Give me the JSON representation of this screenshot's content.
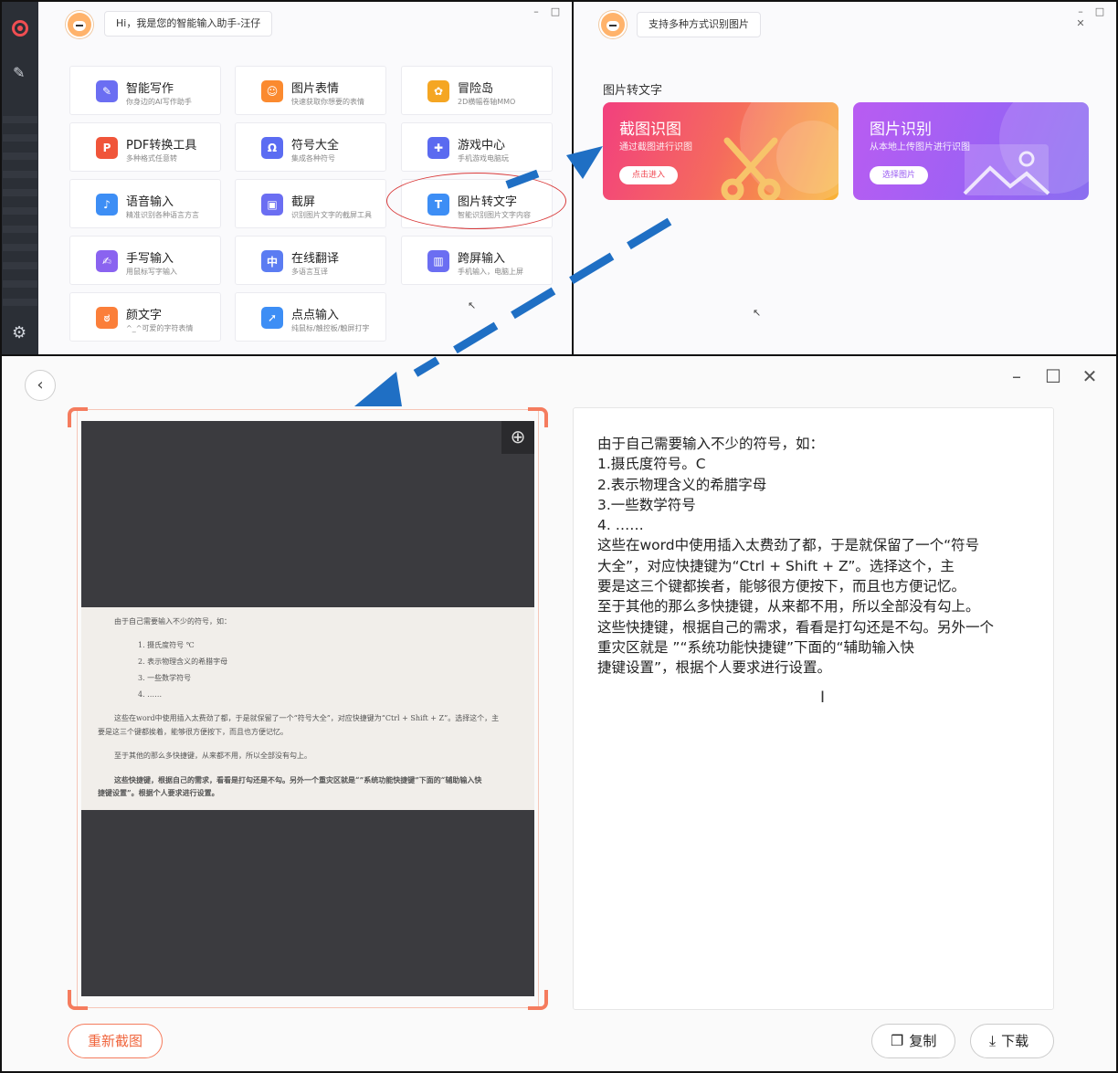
{
  "home": {
    "greeting": "Hi，我是您的智能输入助手-汪仔",
    "cards": [
      {
        "title": "智能写作",
        "subtitle": "你身边的AI写作助手",
        "icon": "pen-icon",
        "color": "#6b6ef2"
      },
      {
        "title": "图片表情",
        "subtitle": "快速获取你想要的表情",
        "icon": "smile-icon",
        "color": "#fb8a2f"
      },
      {
        "title": "冒险岛",
        "subtitle": "2D横幅卷轴MMO",
        "icon": "mushroom-game-icon",
        "color": "#f5a623"
      },
      {
        "title": "PDF转换工具",
        "subtitle": "多种格式任意转",
        "icon": "pdf-icon",
        "color": "#f0553a"
      },
      {
        "title": "符号大全",
        "subtitle": "集成各种符号",
        "icon": "omega-icon",
        "color": "#5b6cf2"
      },
      {
        "title": "游戏中心",
        "subtitle": "手机游戏电脑玩",
        "icon": "gamepad-icon",
        "color": "#5a6af0"
      },
      {
        "title": "语音输入",
        "subtitle": "精准识别各种语言方言",
        "icon": "microphone-icon",
        "color": "#3d8ef5"
      },
      {
        "title": "截屏",
        "subtitle": "识别图片文字的截屏工具",
        "icon": "screenshot-icon",
        "color": "#6b6ef2"
      },
      {
        "title": "图片转文字",
        "subtitle": "智能识别图片文字内容",
        "icon": "image-text-icon",
        "color": "#3d8ef5"
      },
      {
        "title": "手写输入",
        "subtitle": "用鼠标写字输入",
        "icon": "handwriting-icon",
        "color": "#8a63f0"
      },
      {
        "title": "在线翻译",
        "subtitle": "多语言互译",
        "icon": "translate-icon",
        "color": "#5b7cf2"
      },
      {
        "title": "跨屏输入",
        "subtitle": "手机输入，电脑上屏",
        "icon": "cross-screen-icon",
        "color": "#6b6ef2"
      },
      {
        "title": "颜文字",
        "subtitle": "^_^可爱的字符表情",
        "icon": "emoticon-icon",
        "color": "#fb7f3a"
      },
      {
        "title": "点点输入",
        "subtitle": "纯鼠标/触控板/触屏打字",
        "icon": "pointer-icon",
        "color": "#3d8ef5"
      }
    ]
  },
  "ocr": {
    "header": "支持多种方式识别图片",
    "section_title": "图片转文字",
    "screenshot_ocr": {
      "title": "截图识图",
      "subtitle": "通过截图进行识图",
      "button": "点击进入"
    },
    "image_ocr": {
      "title": "图片识别",
      "subtitle": "从本地上传图片进行识图",
      "button": "选择图片"
    }
  },
  "result": {
    "source_doc": {
      "intro": "由于自己需要输入不少的符号，如：",
      "items": [
        "1. 摄氏度符号 ℃",
        "2. 表示物理含义的希腊字母",
        "3. 一些数学符号",
        "4. ……"
      ],
      "para1_a": "这些在word中使用插入太费劲了都，于是就保留了一个“符号大全”，对应快捷键为“Ctrl + Shift + Z”。选择这个，主",
      "para1_b": "要是这三个键都挨着，能够很方便按下，而且也方便记忆。",
      "para2": "至于其他的那么多快捷键，从来都不用，所以全部没有勾上。",
      "para3_a": "这些快捷键，根据自己的需求，看看是打勾还是不勾。另外一个重灾区就是“”系统功能快捷键”下面的“辅助输入快",
      "para3_b": "捷键设置”。根据个人要求进行设置。"
    },
    "recognized_lines": [
      "由于自己需要输入不少的符号，如：",
      "1.摄氏度符号。C",
      "2.表示物理含义的希腊字母",
      "3.一些数学符号",
      "4. ……",
      "这些在word中使用插入太费劲了都，于是就保留了一个“符号",
      "大全”，对应快捷键为“Ctrl + Shift + Z”。选择这个，主",
      "要是这三个键都挨者，能够很方便按下，而且也方便记忆。",
      "至于其他的那么多快捷键，从来都不用，所以全部没有勾上。",
      "这些快捷键，根据自己的需求，看看是打勾还是不勾。另外一个",
      "重灾区就是 ”“系统功能快捷键”下面的“辅助输入快",
      "捷键设置”，根据个人要求进行设置。"
    ],
    "retake_button": "重新截图",
    "copy_button": "复制",
    "download_button": "下载"
  },
  "colors": {
    "accent": "#f57c5e",
    "arrow": "#1f6fc4",
    "highlight": "#d93a3a"
  }
}
